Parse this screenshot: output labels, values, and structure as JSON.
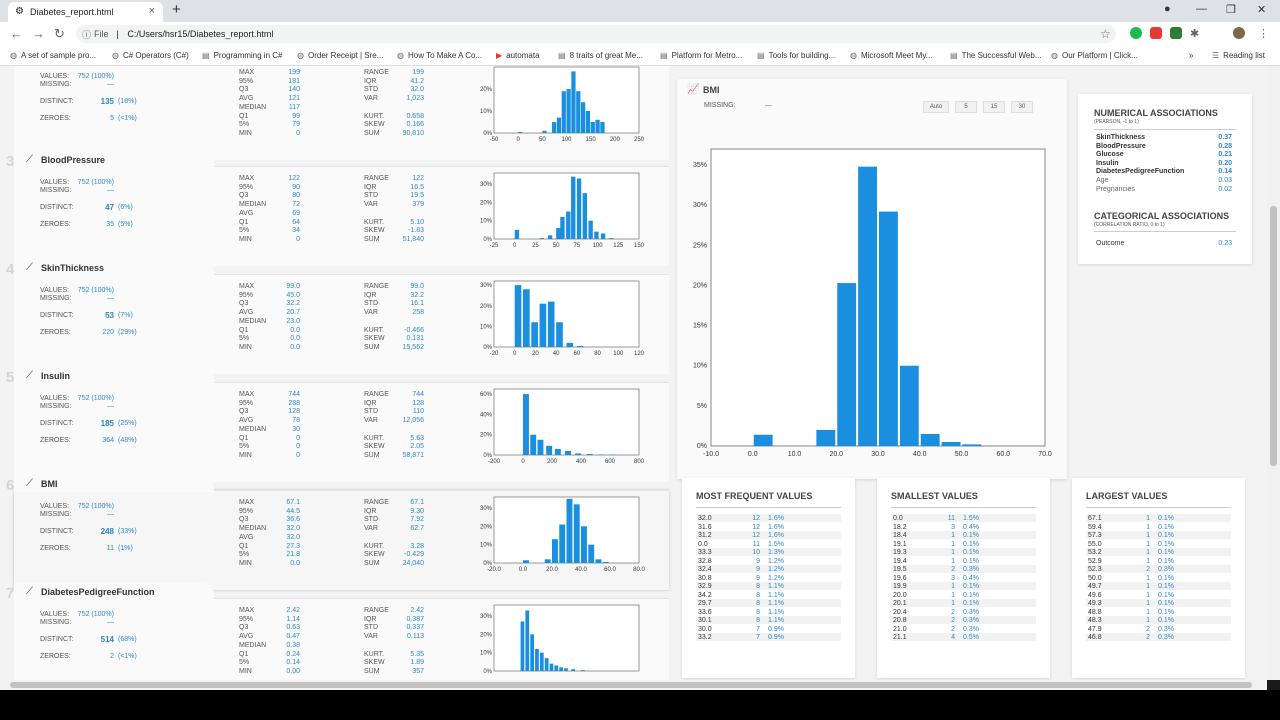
{
  "browser": {
    "tab_title": "Diabetes_report.html",
    "url_scheme": "File",
    "url": "C:/Users/hsr15/Diabetes_report.html",
    "reading_list": "Reading list",
    "bookmarks": [
      "A set of sample pro...",
      "C# Operators (C#)",
      "Programming in C#",
      "Order Receipt | Sre...",
      "How To Make A Co...",
      "automata",
      "8 traits of great Me...",
      "Platform for Metro...",
      "Tools for building...",
      "Microsoft Meet My...",
      "The Successful Web...",
      "Our Platform | Click..."
    ]
  },
  "labels": {
    "values": "VALUES:",
    "missing": "MISSING:",
    "distinct": "DISTINCT:",
    "zeroes": "ZEROES:",
    "max": "MAX",
    "p95": "95%",
    "q3": "Q3",
    "avg": "AVG",
    "median": "MEDIAN",
    "q1": "Q1",
    "p5": "5%",
    "min": "MIN",
    "range": "RANGE",
    "iqr": "IQR",
    "std": "STD",
    "var": "VAR",
    "kurt": "KURT.",
    "skew": "SKEW",
    "sum": "SUM"
  },
  "variables": [
    {
      "num": "",
      "title": "",
      "values": "752 (100%)",
      "missing": "—",
      "distinct": "135",
      "distinct_pct": "(18%)",
      "zeroes": "5",
      "zeroes_pct": "(<1%)",
      "max": "199",
      "p95": "181",
      "q3": "140",
      "avg": "121",
      "median": "117",
      "q1": "99",
      "p5": "79",
      "min": "0",
      "range": "199",
      "iqr": "41.2",
      "std": "32.0",
      "var": "1,023",
      "kurt": "0.658",
      "skew": "0.166",
      "sum": "90,810",
      "hist": {
        "xticks": [
          "-50",
          "0",
          "50",
          "100",
          "150",
          "200",
          "250"
        ],
        "xmin": -50,
        "xmax": 250,
        "yticks": [
          "0%",
          "10%",
          "20%"
        ],
        "ymax": 0.3,
        "bars": [
          [
            0,
            0.005
          ],
          [
            50,
            0.01
          ],
          [
            70,
            0.05
          ],
          [
            80,
            0.07
          ],
          [
            90,
            0.19
          ],
          [
            100,
            0.2
          ],
          [
            110,
            0.28
          ],
          [
            120,
            0.19
          ],
          [
            130,
            0.14
          ],
          [
            140,
            0.1
          ],
          [
            150,
            0.05
          ],
          [
            160,
            0.06
          ],
          [
            170,
            0.05
          ]
        ],
        "bw": 10
      }
    },
    {
      "num": "3",
      "title": "BloodPressure",
      "values": "752 (100%)",
      "missing": "—",
      "distinct": "47",
      "distinct_pct": "(6%)",
      "zeroes": "35",
      "zeroes_pct": "(5%)",
      "max": "122",
      "p95": "90",
      "q3": "80",
      "median": "72",
      "avg": "69",
      "q1": "64",
      "p5": "34",
      "min": "0",
      "range": "122",
      "iqr": "16.5",
      "std": "19.5",
      "var": "379",
      "kurt": "5.10",
      "skew": "-1.83",
      "sum": "51,840",
      "hist": {
        "xticks": [
          "-25",
          "0",
          "25",
          "50",
          "75",
          "100",
          "125",
          "150"
        ],
        "xmin": -25,
        "xmax": 150,
        "yticks": [
          "0%",
          "10%",
          "20%",
          "30%"
        ],
        "ymax": 0.36,
        "bars": [
          [
            0,
            0.05
          ],
          [
            30,
            0.005
          ],
          [
            40,
            0.02
          ],
          [
            50,
            0.06
          ],
          [
            55,
            0.12
          ],
          [
            62,
            0.15
          ],
          [
            68,
            0.34
          ],
          [
            75,
            0.33
          ],
          [
            82,
            0.25
          ],
          [
            89,
            0.1
          ],
          [
            96,
            0.04
          ],
          [
            104,
            0.03
          ],
          [
            114,
            0.005
          ]
        ],
        "bw": 6
      }
    },
    {
      "num": "4",
      "title": "SkinThickness",
      "values": "752 (100%)",
      "missing": "—",
      "distinct": "53",
      "distinct_pct": "(7%)",
      "zeroes": "220",
      "zeroes_pct": "(29%)",
      "max": "99.0",
      "p95": "45.0",
      "q3": "32.2",
      "median": "23.0",
      "avg": "20.7",
      "q1": "0.0",
      "p5": "0.0",
      "min": "0.0",
      "range": "99.0",
      "iqr": "32.2",
      "std": "16.1",
      "var": "258",
      "kurt": "-0.466",
      "skew": "0.131",
      "sum": "15,562",
      "hist": {
        "xticks": [
          "-20",
          "0",
          "20",
          "40",
          "60",
          "80",
          "100",
          "120"
        ],
        "xmin": -20,
        "xmax": 120,
        "yticks": [
          "0%",
          "10%",
          "20%",
          "30%"
        ],
        "ymax": 0.32,
        "bars": [
          [
            0,
            0.3
          ],
          [
            8,
            0.28
          ],
          [
            16,
            0.12
          ],
          [
            24,
            0.21
          ],
          [
            32,
            0.22
          ],
          [
            40,
            0.12
          ],
          [
            50,
            0.02
          ],
          [
            60,
            0.005
          ]
        ],
        "bw": 7
      }
    },
    {
      "num": "5",
      "title": "Insulin",
      "values": "752 (100%)",
      "missing": "—",
      "distinct": "185",
      "distinct_pct": "(25%)",
      "zeroes": "364",
      "zeroes_pct": "(48%)",
      "max": "744",
      "p95": "288",
      "q3": "128",
      "avg": "78",
      "median": "30",
      "q1": "0",
      "p5": "0",
      "min": "0",
      "range": "744",
      "iqr": "128",
      "std": "110",
      "var": "12,056",
      "kurt": "5.63",
      "skew": "2.05",
      "sum": "58,871",
      "hist": {
        "xticks": [
          "-200",
          "0",
          "200",
          "400",
          "600",
          "800"
        ],
        "xmin": -200,
        "xmax": 800,
        "yticks": [
          "0%",
          "20%",
          "40%",
          "60%"
        ],
        "ymax": 0.65,
        "bars": [
          [
            0,
            0.6
          ],
          [
            50,
            0.2
          ],
          [
            100,
            0.15
          ],
          [
            160,
            0.09
          ],
          [
            220,
            0.06
          ],
          [
            290,
            0.04
          ],
          [
            360,
            0.015
          ],
          [
            440,
            0.01
          ],
          [
            520,
            0.005
          ],
          [
            600,
            0.005
          ]
        ],
        "bw": 45
      }
    },
    {
      "num": "6",
      "title": "BMI",
      "values": "752 (100%)",
      "missing": "—",
      "distinct": "248",
      "distinct_pct": "(33%)",
      "zeroes": "11",
      "zeroes_pct": "(1%)",
      "max": "67.1",
      "p95": "44.5",
      "q3": "36.6",
      "median": "32.0",
      "avg": "32.0",
      "q1": "27.3",
      "p5": "21.8",
      "min": "0.0",
      "range": "67.1",
      "iqr": "9.30",
      "std": "7.92",
      "var": "62.7",
      "kurt": "3.28",
      "skew": "-0.429",
      "sum": "24,040",
      "hist": {
        "xticks": [
          "-20.0",
          "0.0",
          "20.0",
          "40.0",
          "60.0",
          "80.0"
        ],
        "xmin": -20,
        "xmax": 80,
        "yticks": [
          "0%",
          "10%",
          "20%",
          "30%"
        ],
        "ymax": 0.36,
        "bars": [
          [
            0,
            0.015
          ],
          [
            15,
            0.02
          ],
          [
            20,
            0.13
          ],
          [
            25,
            0.21
          ],
          [
            30,
            0.35
          ],
          [
            35,
            0.32
          ],
          [
            40,
            0.2
          ],
          [
            45,
            0.1
          ],
          [
            50,
            0.02
          ],
          [
            55,
            0.005
          ]
        ],
        "bw": 4.5
      }
    },
    {
      "num": "7",
      "title": "DiabetesPedigreeFunction",
      "values": "752 (100%)",
      "missing": "—",
      "distinct": "514",
      "distinct_pct": "(68%)",
      "zeroes": "2",
      "zeroes_pct": "(<1%)",
      "max": "2.42",
      "p95": "1.14",
      "q3": "0.63",
      "avg": "0.47",
      "median": "0.38",
      "q1": "0.24",
      "p5": "0.14",
      "min": "0.00",
      "range": "2.42",
      "iqr": "0.387",
      "std": "0.337",
      "var": "0.113",
      "kurt": "5.35",
      "skew": "1.89",
      "sum": "357",
      "hist": {
        "xticks": [],
        "xmin": -0.5,
        "xmax": 2.5,
        "yticks": [
          "0%",
          "10%",
          "20%",
          "30%"
        ],
        "ymax": 0.36,
        "bars": [
          [
            0.05,
            0.27
          ],
          [
            0.15,
            0.33
          ],
          [
            0.25,
            0.2
          ],
          [
            0.35,
            0.12
          ],
          [
            0.45,
            0.1
          ],
          [
            0.55,
            0.07
          ],
          [
            0.65,
            0.04
          ],
          [
            0.75,
            0.03
          ],
          [
            0.85,
            0.02
          ],
          [
            0.95,
            0.015
          ],
          [
            1.1,
            0.01
          ],
          [
            1.3,
            0.005
          ]
        ],
        "bw": 0.09
      }
    }
  ],
  "detail": {
    "title": "BMI",
    "missing_label": "MISSING:",
    "missing_value": "—",
    "buttons": [
      "Auto",
      "5",
      "15",
      "30"
    ],
    "chart_data": {
      "type": "bar",
      "xticks": [
        "-10.0",
        "0.0",
        "10.0",
        "20.0",
        "30.0",
        "40.0",
        "50.0",
        "60.0",
        "70.0"
      ],
      "xlim": [
        -10,
        70
      ],
      "yticks": [
        "0%",
        "5%",
        "10%",
        "15%",
        "20%",
        "25%",
        "30%",
        "35%"
      ],
      "ylim": [
        0,
        0.37
      ],
      "bins": [
        [
          0,
          5,
          0.014
        ],
        [
          15,
          20,
          0.02
        ],
        [
          20,
          25,
          0.203
        ],
        [
          25,
          30,
          0.348
        ],
        [
          30,
          35,
          0.292
        ],
        [
          35,
          40,
          0.1
        ],
        [
          40,
          45,
          0.015
        ],
        [
          45,
          50,
          0.005
        ],
        [
          50,
          55,
          0.002
        ]
      ]
    }
  },
  "associations": {
    "numerical_title": "NUMERICAL ASSOCIATIONS",
    "numerical_sub": "(PEARSON, -1 to 1)",
    "numerical": [
      [
        "SkinThickness",
        "0.37"
      ],
      [
        "BloodPressure",
        "0.28"
      ],
      [
        "Glucose",
        "0.21"
      ],
      [
        "Insulin",
        "0.20"
      ],
      [
        "DiabetesPedigreeFunction",
        "0.14"
      ],
      [
        "Age",
        "0.03"
      ],
      [
        "Pregnancies",
        "0.02"
      ]
    ],
    "categorical_title": "CATEGORICAL ASSOCIATIONS",
    "categorical_sub": "(CORRELATION RATIO, 0 to 1)",
    "categorical": [
      [
        "Outcome",
        "0.23"
      ]
    ]
  },
  "tables": {
    "frequent_title": "MOST FREQUENT VALUES",
    "smallest_title": "SMALLEST VALUES",
    "largest_title": "LARGEST VALUES",
    "frequent": [
      [
        "32.0",
        "12",
        "1.6%"
      ],
      [
        "31.6",
        "12",
        "1.6%"
      ],
      [
        "31.2",
        "12",
        "1.6%"
      ],
      [
        "0.0",
        "11",
        "1.5%"
      ],
      [
        "33.3",
        "10",
        "1.3%"
      ],
      [
        "32.8",
        "9",
        "1.2%"
      ],
      [
        "32.4",
        "9",
        "1.2%"
      ],
      [
        "30.8",
        "9",
        "1.2%"
      ],
      [
        "32.9",
        "8",
        "1.1%"
      ],
      [
        "34.2",
        "8",
        "1.1%"
      ],
      [
        "29.7",
        "8",
        "1.1%"
      ],
      [
        "33.6",
        "8",
        "1.1%"
      ],
      [
        "30.1",
        "8",
        "1.1%"
      ],
      [
        "30.0",
        "7",
        "0.9%"
      ],
      [
        "33.2",
        "7",
        "0.9%"
      ]
    ],
    "smallest": [
      [
        "0.0",
        "11",
        "1.5%"
      ],
      [
        "18.2",
        "3",
        "0.4%"
      ],
      [
        "18.4",
        "1",
        "0.1%"
      ],
      [
        "19.1",
        "1",
        "0.1%"
      ],
      [
        "19.3",
        "1",
        "0.1%"
      ],
      [
        "19.4",
        "1",
        "0.1%"
      ],
      [
        "19.5",
        "2",
        "0.3%"
      ],
      [
        "19.6",
        "3",
        "0.4%"
      ],
      [
        "19.9",
        "1",
        "0.1%"
      ],
      [
        "20.0",
        "1",
        "0.1%"
      ],
      [
        "20.1",
        "1",
        "0.1%"
      ],
      [
        "20.4",
        "2",
        "0.3%"
      ],
      [
        "20.8",
        "2",
        "0.3%"
      ],
      [
        "21.0",
        "2",
        "0.3%"
      ],
      [
        "21.1",
        "4",
        "0.5%"
      ]
    ],
    "largest": [
      [
        "67.1",
        "1",
        "0.1%"
      ],
      [
        "59.4",
        "1",
        "0.1%"
      ],
      [
        "57.3",
        "1",
        "0.1%"
      ],
      [
        "55.0",
        "1",
        "0.1%"
      ],
      [
        "53.2",
        "1",
        "0.1%"
      ],
      [
        "52.9",
        "1",
        "0.1%"
      ],
      [
        "52.3",
        "2",
        "0.3%"
      ],
      [
        "50.0",
        "1",
        "0.1%"
      ],
      [
        "49.7",
        "1",
        "0.1%"
      ],
      [
        "49.6",
        "1",
        "0.1%"
      ],
      [
        "49.3",
        "1",
        "0.1%"
      ],
      [
        "48.8",
        "1",
        "0.1%"
      ],
      [
        "48.3",
        "1",
        "0.1%"
      ],
      [
        "47.9",
        "2",
        "0.3%"
      ],
      [
        "46.8",
        "2",
        "0.3%"
      ]
    ]
  },
  "colors": {
    "accent": "#2e86c9",
    "bar": "#1a8fe0"
  }
}
